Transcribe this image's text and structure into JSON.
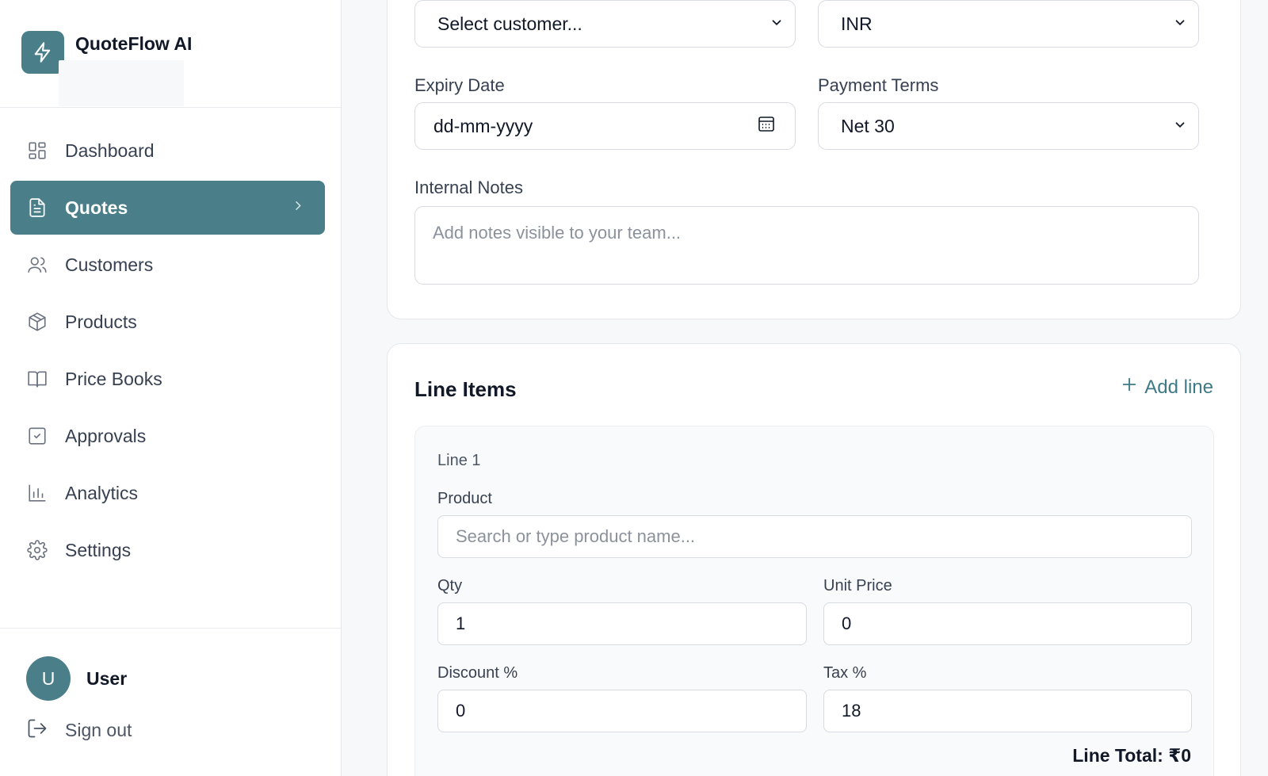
{
  "app": {
    "name": "QuoteFlow AI",
    "accent_color": "#4a7f8a"
  },
  "sidebar": {
    "items": [
      {
        "label": "Dashboard",
        "icon": "dashboard-icon"
      },
      {
        "label": "Quotes",
        "icon": "document-icon",
        "active": true
      },
      {
        "label": "Customers",
        "icon": "users-icon"
      },
      {
        "label": "Products",
        "icon": "package-icon"
      },
      {
        "label": "Price Books",
        "icon": "book-icon"
      },
      {
        "label": "Approvals",
        "icon": "check-square-icon"
      },
      {
        "label": "Analytics",
        "icon": "bar-chart-icon"
      },
      {
        "label": "Settings",
        "icon": "gear-icon"
      }
    ],
    "user": {
      "initial": "U",
      "name": "User"
    },
    "signout_label": "Sign out"
  },
  "quote_form": {
    "customer_select": {
      "value": "Select customer..."
    },
    "currency_select": {
      "value": "INR"
    },
    "expiry_date": {
      "label": "Expiry Date",
      "placeholder": "dd-mm-yyyy"
    },
    "payment_terms": {
      "label": "Payment Terms",
      "value": "Net 30"
    },
    "internal_notes": {
      "label": "Internal Notes",
      "placeholder": "Add notes visible to your team..."
    }
  },
  "line_items": {
    "title": "Line Items",
    "add_line_label": "Add line",
    "lines": [
      {
        "title": "Line 1",
        "product_label": "Product",
        "product_placeholder": "Search or type product name...",
        "qty_label": "Qty",
        "qty": "1",
        "unit_price_label": "Unit Price",
        "unit_price": "0",
        "discount_label": "Discount %",
        "discount": "0",
        "tax_label": "Tax %",
        "tax": "18",
        "line_total": "Line Total: ₹0"
      }
    ]
  }
}
